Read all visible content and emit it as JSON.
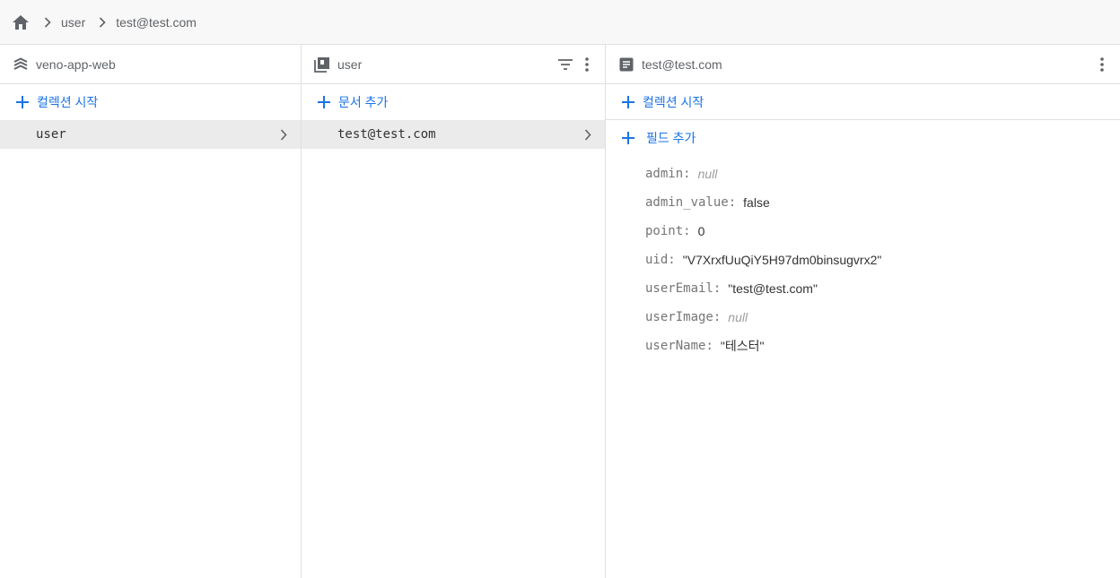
{
  "breadcrumb": {
    "items": [
      "user",
      "test@test.com"
    ]
  },
  "panels": {
    "project": {
      "title": "veno-app-web",
      "add_label": "컬렉션 시작",
      "items": [
        {
          "label": "user"
        }
      ]
    },
    "collection": {
      "title": "user",
      "add_label": "문서 추가",
      "items": [
        {
          "label": "test@test.com"
        }
      ]
    },
    "document": {
      "title": "test@test.com",
      "add_collection_label": "컬렉션 시작",
      "add_field_label": "필드 추가",
      "fields": [
        {
          "key": "admin",
          "value": "null",
          "is_null": true
        },
        {
          "key": "admin_value",
          "value": "false",
          "is_null": false
        },
        {
          "key": "point",
          "value": "0",
          "is_null": false
        },
        {
          "key": "uid",
          "value": "\"V7XrxfUuQiY5H97dm0binsugvrx2\"",
          "is_null": false
        },
        {
          "key": "userEmail",
          "value": "\"test@test.com\"",
          "is_null": false
        },
        {
          "key": "userImage",
          "value": "null",
          "is_null": true
        },
        {
          "key": "userName",
          "value": "\"테스터\"",
          "is_null": false
        }
      ]
    }
  },
  "colors": {
    "accent": "#1a73e8",
    "icon": "#5f6368",
    "selected_row": "#ebebeb",
    "border": "#e0e0e0"
  },
  "icons": {
    "home": "home-icon",
    "separator": "chevron-right-icon",
    "project": "firebase-stack-icon",
    "collection": "collection-icon",
    "document": "document-icon",
    "filter": "filter-icon",
    "menu": "more-vert-icon",
    "add": "plus-icon",
    "expand": "chevron-right-icon"
  }
}
